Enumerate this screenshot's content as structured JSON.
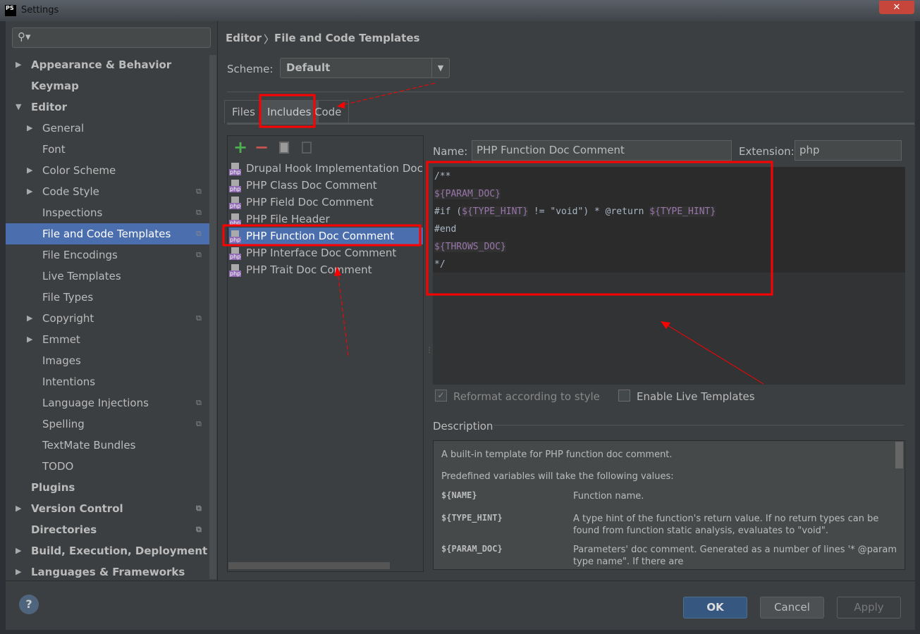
{
  "window": {
    "title": "Settings",
    "logo": "PS",
    "close": "✕"
  },
  "sidebar": {
    "items": [
      {
        "label": "Appearance & Behavior",
        "level": 0,
        "bold": true,
        "arrow": "right"
      },
      {
        "label": "Keymap",
        "level": 0,
        "bold": true
      },
      {
        "label": "Editor",
        "level": 0,
        "bold": true,
        "arrow": "down"
      },
      {
        "label": "General",
        "level": 1,
        "arrow": "right"
      },
      {
        "label": "Font",
        "level": 1
      },
      {
        "label": "Color Scheme",
        "level": 1,
        "arrow": "right"
      },
      {
        "label": "Code Style",
        "level": 1,
        "arrow": "right",
        "copy": true
      },
      {
        "label": "Inspections",
        "level": 1,
        "copy": true
      },
      {
        "label": "File and Code Templates",
        "level": 1,
        "copy": true,
        "selected": true
      },
      {
        "label": "File Encodings",
        "level": 1,
        "copy": true
      },
      {
        "label": "Live Templates",
        "level": 1
      },
      {
        "label": "File Types",
        "level": 1
      },
      {
        "label": "Copyright",
        "level": 1,
        "arrow": "right",
        "copy": true
      },
      {
        "label": "Emmet",
        "level": 1,
        "arrow": "right"
      },
      {
        "label": "Images",
        "level": 1
      },
      {
        "label": "Intentions",
        "level": 1
      },
      {
        "label": "Language Injections",
        "level": 1,
        "copy": true
      },
      {
        "label": "Spelling",
        "level": 1,
        "copy": true
      },
      {
        "label": "TextMate Bundles",
        "level": 1
      },
      {
        "label": "TODO",
        "level": 1
      },
      {
        "label": "Plugins",
        "level": 0,
        "bold": true
      },
      {
        "label": "Version Control",
        "level": 0,
        "bold": true,
        "arrow": "right",
        "copy": true
      },
      {
        "label": "Directories",
        "level": 0,
        "bold": true,
        "copy": true
      },
      {
        "label": "Build, Execution, Deployment",
        "level": 0,
        "bold": true,
        "arrow": "right"
      },
      {
        "label": "Languages & Frameworks",
        "level": 0,
        "bold": true,
        "arrow": "right"
      }
    ]
  },
  "breadcrumb": {
    "parent": "Editor",
    "separator": "〉",
    "current": "File and Code Templates"
  },
  "scheme": {
    "label": "Scheme:",
    "value": "Default"
  },
  "tabs": [
    {
      "label": "Files"
    },
    {
      "label": "Includes",
      "active": true
    },
    {
      "label": "Code"
    }
  ],
  "toolbar": {
    "add": "+",
    "remove": "−"
  },
  "templates": [
    "Drupal Hook Implementation Doc Comment",
    "PHP Class Doc Comment",
    "PHP Field Doc Comment",
    "PHP File Header",
    "PHP Function Doc Comment",
    "PHP Interface Doc Comment",
    "PHP Trait Doc Comment"
  ],
  "selected_template": "PHP Function Doc Comment",
  "name_label": "Name:",
  "name_value": "PHP Function Doc Comment",
  "extension_label": "Extension:",
  "extension_value": "php",
  "code": {
    "l1": "/**",
    "l2": "${PARAM_DOC}",
    "l3a": "#if (",
    "l3b": "${TYPE_HINT}",
    "l3c": " != \"void\") * @return ",
    "l3d": "${TYPE_HINT}",
    "l4": "#end",
    "l5": "${THROWS_DOC}",
    "l6": "*/"
  },
  "options": {
    "reformat": "Reformat according to style",
    "reformat_checked": true,
    "reformat_enabled": false,
    "live": "Enable Live Templates",
    "live_checked": false
  },
  "description": {
    "label": "Description",
    "intro": "A built-in template for PHP function doc comment.",
    "predefined": "Predefined variables will take the following values:",
    "vars": [
      {
        "name": "${NAME}",
        "text": "Function name."
      },
      {
        "name": "${TYPE_HINT}",
        "text": "A type hint of the function's return value. If no return types can be found from function static analysis, evaluates to \"void\"."
      },
      {
        "name": "${PARAM_DOC}",
        "text": "Parameters' doc comment. Generated as a number of lines '* @param type name\". If there are"
      }
    ]
  },
  "buttons": {
    "help": "?",
    "ok": "OK",
    "cancel": "Cancel",
    "apply": "Apply"
  },
  "colors": {
    "accent": "#4b6eaf",
    "background": "#3c3f41",
    "editor": "#2b2b2b",
    "annotation": "#ff0000",
    "variable": "#9876aa"
  }
}
